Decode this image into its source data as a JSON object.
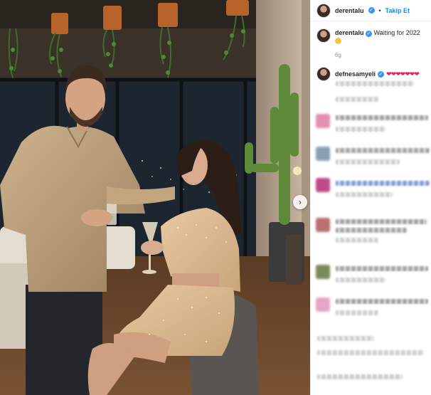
{
  "post": {
    "author": "derentalu",
    "follow_label": "Takip Et",
    "separator": "•",
    "caption_text": "Waiting for 2022",
    "caption_time": "6g"
  },
  "comments": [
    {
      "username": "defnesamyeli",
      "text": "❤❤❤❤❤❤❤"
    }
  ],
  "icons": {
    "verified": "verified-badge-icon",
    "carousel": "chevron-right-icon",
    "emoji": "smiling-face-emoji-icon"
  },
  "colors": {
    "accent": "#0095f6",
    "verified": "#3897f0",
    "heart": "#e0245e",
    "muted": "#8e8e8e"
  }
}
